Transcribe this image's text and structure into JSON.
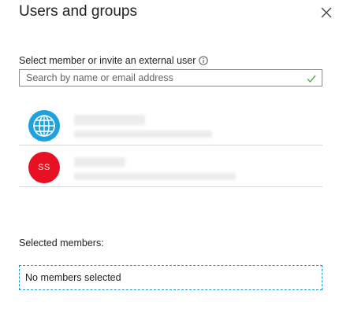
{
  "panel": {
    "title": "Users and groups"
  },
  "search": {
    "label": "Select member or invite an external user",
    "placeholder": "Search by name or email address"
  },
  "results": [
    {
      "avatar_type": "globe-icon",
      "initials": "",
      "avatar_color": "#1ea1e0"
    },
    {
      "avatar_type": "initials",
      "initials": "SS",
      "avatar_color": "#e81123"
    }
  ],
  "selected": {
    "label": "Selected members:",
    "empty_text": "No members selected"
  },
  "icons": {
    "close": "close-icon",
    "info": "info-icon",
    "check": "checkmark-icon"
  },
  "colors": {
    "accent": "#1b8fd0",
    "check": "#4caf50",
    "avatar_red": "#e81123",
    "avatar_blue": "#1ea1e0"
  }
}
